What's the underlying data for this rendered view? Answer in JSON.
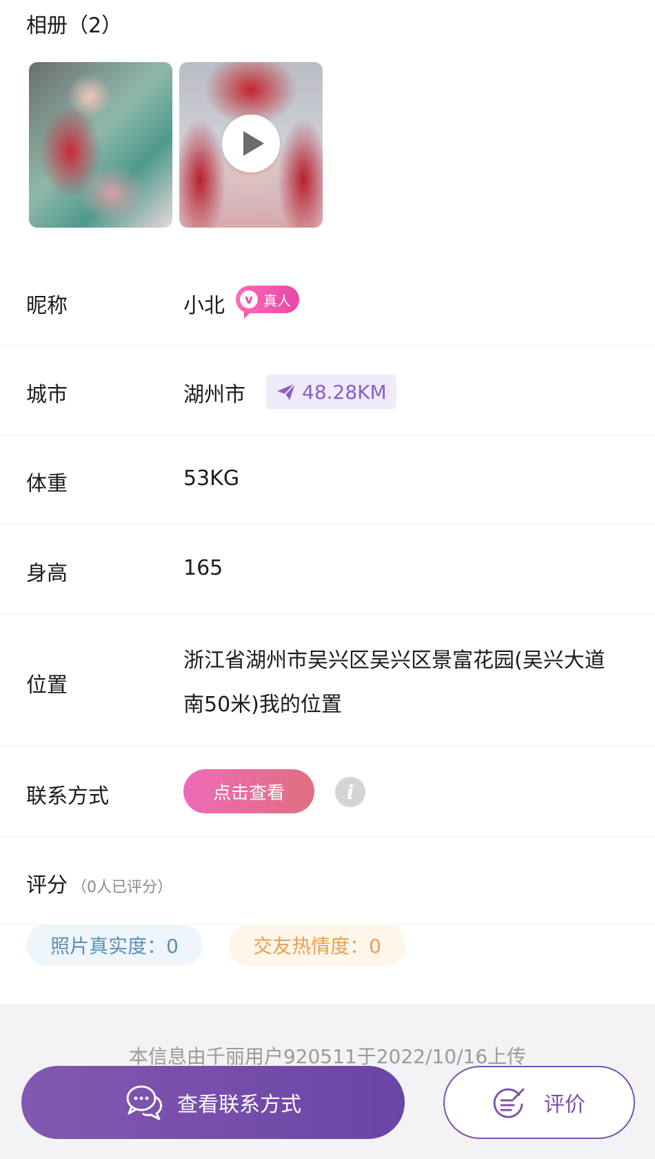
{
  "album": {
    "title": "相册（2）"
  },
  "profile": {
    "nickname_label": "昵称",
    "nickname": "小北",
    "verified_badge": "真人",
    "city_label": "城市",
    "city": "湖州市",
    "distance": "48.28KM",
    "weight_label": "体重",
    "weight": "53KG",
    "height_label": "身高",
    "height": "165",
    "location_label": "位置",
    "location_line1": "浙江省湖州市吴兴区吴兴区景富花园(吴兴大道",
    "location_line2": "南50米)我的位置",
    "contact_label": "联系方式",
    "contact_button": "点击查看"
  },
  "rating": {
    "label": "评分",
    "count_text": "（0人已评分）",
    "photo_authenticity": "照片真实度：0",
    "friendliness": "交友热情度：0"
  },
  "footer": {
    "uploader_text": "本信息由千丽用户920511于2022/10/16上传",
    "contact_button": "查看联系方式",
    "review_button": "评价"
  },
  "colors": {
    "primary_purple": "#7b4fb0",
    "badge_pink": "#e848a8",
    "photo_pill_text": "#5b8fb3",
    "friend_pill_text": "#e6a050"
  }
}
